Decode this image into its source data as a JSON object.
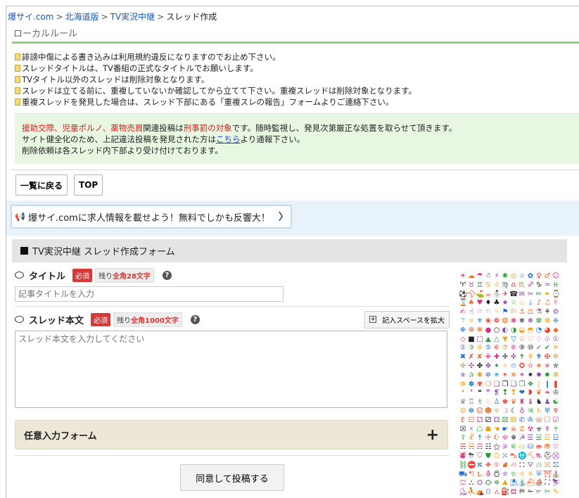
{
  "breadcrumb": [
    {
      "label": "爆サイ.com",
      "link": true
    },
    {
      "label": "北海道版",
      "link": true
    },
    {
      "label": "TV実況中継",
      "link": true
    },
    {
      "label": "スレッド作成",
      "link": false
    }
  ],
  "local_rules": {
    "title": "ローカルルール",
    "items": [
      "誹謗中傷による書き込みは利用規約違反になりますのでお止め下さい。",
      "スレッドタイトルは、TV番組の正式なタイトルでお願いします。",
      "TVタイトル以外のスレッドは削除対象となります。",
      "スレッドは立てる前に、重複していないか確認してから立てて下さい。重複スレッドは削除対象となります。",
      "重複スレッドを発見した場合は、スレッド下部にある「重複スレの報告」フォームよりご連絡下さい。"
    ]
  },
  "warning": {
    "red1": "援助交際、児童ポルノ、薬物売買",
    "text1": "関連投稿は",
    "red2": "刑事罰の対象",
    "text2": "です。随時監視し、発見次第厳正な処置を取らせて頂きます。",
    "line2a": "サイト健全化のため、上記違法投稿を発見された方は",
    "line2_link": "こちら",
    "line2b": "より通報下さい。",
    "line3": "削除依頼は各スレッド内下部より受け付けております。"
  },
  "nav": {
    "back_label": "一覧に戻る",
    "top_label": "TOP"
  },
  "ad": {
    "text": "爆サイ.comに求人情報を載せよう！無料でしかも反響大！",
    "chevron": "〉"
  },
  "form": {
    "header": "TV実況中継 スレッド作成フォーム",
    "title_field": {
      "label": "タイトル",
      "required": "必須",
      "remain_prefix": "残り",
      "remain_value": "全角28文字",
      "placeholder": "記事タイトルを入力"
    },
    "body_field": {
      "label": "スレッド本文",
      "required": "必須",
      "remain_prefix": "残り",
      "remain_value": "全角1000文字",
      "placeholder": "スレッド本文を入力してください",
      "expand_label": "記入スペースを拡大"
    },
    "optional_label": "任意入力フォーム",
    "optional_plus": "+",
    "submit_label": "同意して投稿する"
  },
  "emoji_colors": [
    "#e53b2c",
    "#1b6fd1",
    "#f0a21a",
    "#2e9b3a",
    "#8e44ad",
    "#222222",
    "#d63384",
    "#e5702a"
  ],
  "emoji_glyphs": "☀☁☂☃⚡✺◎☆✿♀♂☺♈♉♊♋♌♍♎♏♐♑♒♓⚽⚾⛳☕⛄✈☎✉✂✏✒⌚⌛♠♥♦♣★☆♨♩♪♫✌✍☝☞☜☟⚑⚐⚓⚖⚗⚘⚙⚚⚛⚜❀❁❂❃❄❅❆❇❈❉❊❋●○◐◑◒◓◔◕◆◇■□▲△▼▽♤♡♢♧①②③④⑤⑥⑦⑧⑨⑩✓✔✕✖✗✘✙✚✛✜✝✞✟✠✡✢✣✤✥✦✧✩✪✫✬✭✮✯✰✱✲✳✴✵✶✷✸✹✻✼✽✾❍❏❐❑❒❖❘❙❚❛❜❝❞❡❢❣❤❥❦❧♔♕♖♗♘♙♚♛♜♝♞♟☯☮☸☹☻☼☽☾♁♃♄♅♆♇⚀⚁⚂⚃⚄⚅✆✇☏☐☑☒☓☖☗☚☛☠☡☢☣☤☥☦☧☨☩☪☫☬☭☰☱☲☳☴☵☶☷⚝⚞⚟⛀⛁⛂⛃⛆⛇⛈⛉⛊⛋⛌⛍⛎⛏⛐⛑⛒⛓⛔⛕⛖⛗⛘⛙⛚⛛⛜⛝⛞⛟⛠⛡⛢⛣⛤⛥⛦⛧⛨⛩⛪⛫⛬⛭⛮⛯⛰⛱⛲⛴⛵⛶⛷⛸⛹⛺⛻⛼⛽⛾⛿✁✃✄✎✐✑✓✔"
}
